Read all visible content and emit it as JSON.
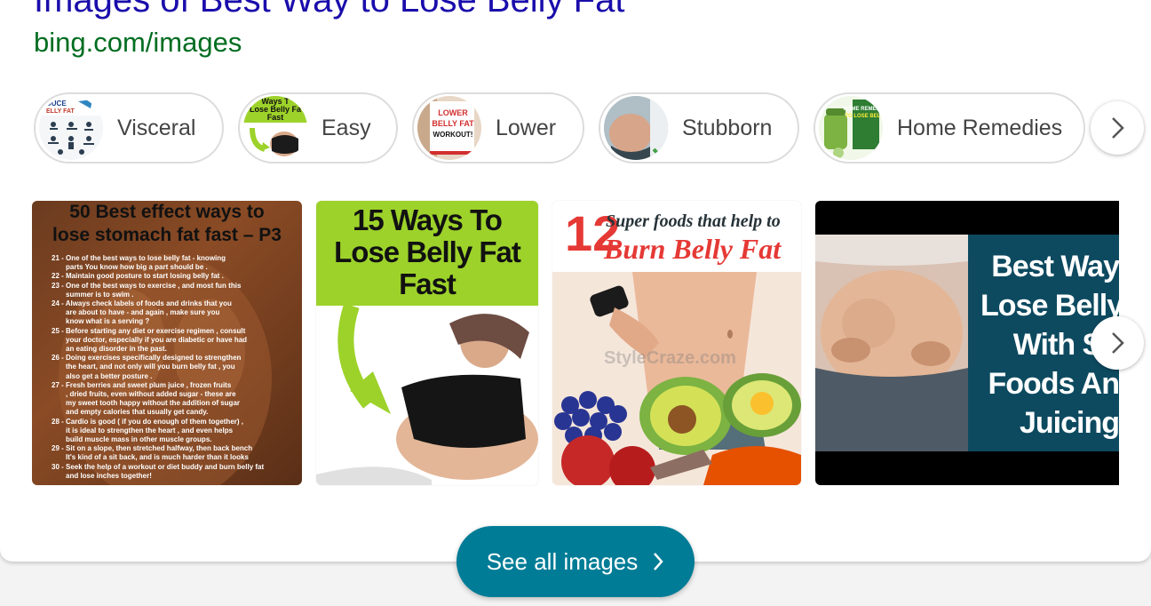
{
  "result": {
    "title": "Images of Best Way to Lose Belly Fat",
    "url": "bing.com/images"
  },
  "chips": [
    {
      "label": "Visceral",
      "thumb_text": "DUCE\nELLY FAT"
    },
    {
      "label": "Easy",
      "thumb_text": "Ways T\nLose Belly Fa\nFast"
    },
    {
      "label": "Lower",
      "thumb_text": "LOWER\nBELLY FAT\nWORKOUT!"
    },
    {
      "label": "Stubborn",
      "thumb_text": ""
    },
    {
      "label": "Home Remedies",
      "thumb_text": "HOME REMEDIES\nTO LOSE BELLY"
    }
  ],
  "tiles": [
    {
      "heading1": "50 Best effect ways to",
      "heading2": "lose stomach fat fast – P3",
      "lines": [
        "21 - One of the best ways to lose belly fat - knowing",
        "parts You know how big a part should be .",
        "22 - Maintain good posture to start losing belly fat .",
        "23 - One of the best ways to exercise , and most fun this",
        "summer is to swim .",
        "24 - Always check labels of foods and drinks that you",
        "are about to have - and again , make sure you",
        "know what is a serving ?",
        "25 - Before starting any diet or exercise regimen , consult",
        "your doctor, especially if you are diabetic or have had",
        "an eating disorder in the past.",
        "26 - Doing exercises specifically designed to strengthen",
        "the heart, and not only will you burn belly fat , you",
        "also get a better posture .",
        "27 -  Fresh berries and sweet plum juice , frozen fruits",
        ", dried fruits, even without added sugar - these are",
        "my sweet tooth happy without the addition of sugar",
        "and empty calories that usually get candy.",
        "28 - Cardio is good ( if you do enough of them together) ,",
        "it is ideal to strengthen the heart , and even helps",
        "build muscle mass in other muscle groups.",
        "29 - Sit on a slope, then stretched halfway, then back bench",
        "It's kind of a sit back, and is much harder than it looks",
        "30 - Seek the help of a workout or diet buddy and burn belly fat",
        "and lose inches together!"
      ]
    },
    {
      "line1": "15 Ways To",
      "line2": "Lose Belly Fat",
      "line3": "Fast"
    },
    {
      "num": "12",
      "line1": "Super foods that help to",
      "line2": "Burn Belly Fat",
      "watermark": "StyleCraze.com"
    },
    {
      "lines": [
        "Best Way",
        "Lose Belly",
        "With Su",
        "Foods An",
        "Juicing"
      ]
    }
  ],
  "see_all": {
    "label": "See all images"
  },
  "colors": {
    "title": "#1a0dab",
    "url": "#006d21",
    "button": "#007c96"
  }
}
